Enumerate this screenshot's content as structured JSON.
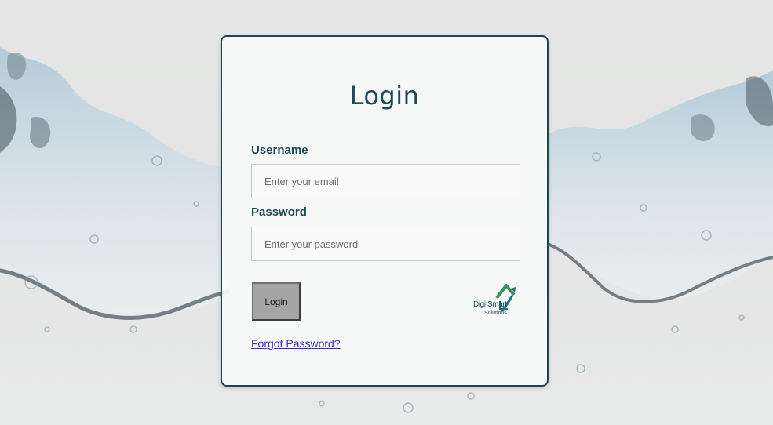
{
  "login": {
    "title": "Login",
    "username": {
      "label": "Username",
      "placeholder": "Enter your email",
      "value": ""
    },
    "password": {
      "label": "Password",
      "placeholder": "Enter your password",
      "value": ""
    },
    "submit_label": "Login",
    "forgot_label": "Forgot Password?"
  },
  "logo": {
    "line1": "Digi Smart",
    "line2": "Solutions",
    "icon": "house-arrow-logo-icon"
  },
  "colors": {
    "accent": "#1e4a52",
    "card_border": "#1d4750",
    "button_bg": "#a5a5a5",
    "link": "#3b28c7",
    "logo_green": "#3a8f5a",
    "logo_teal": "#1f6f86"
  }
}
